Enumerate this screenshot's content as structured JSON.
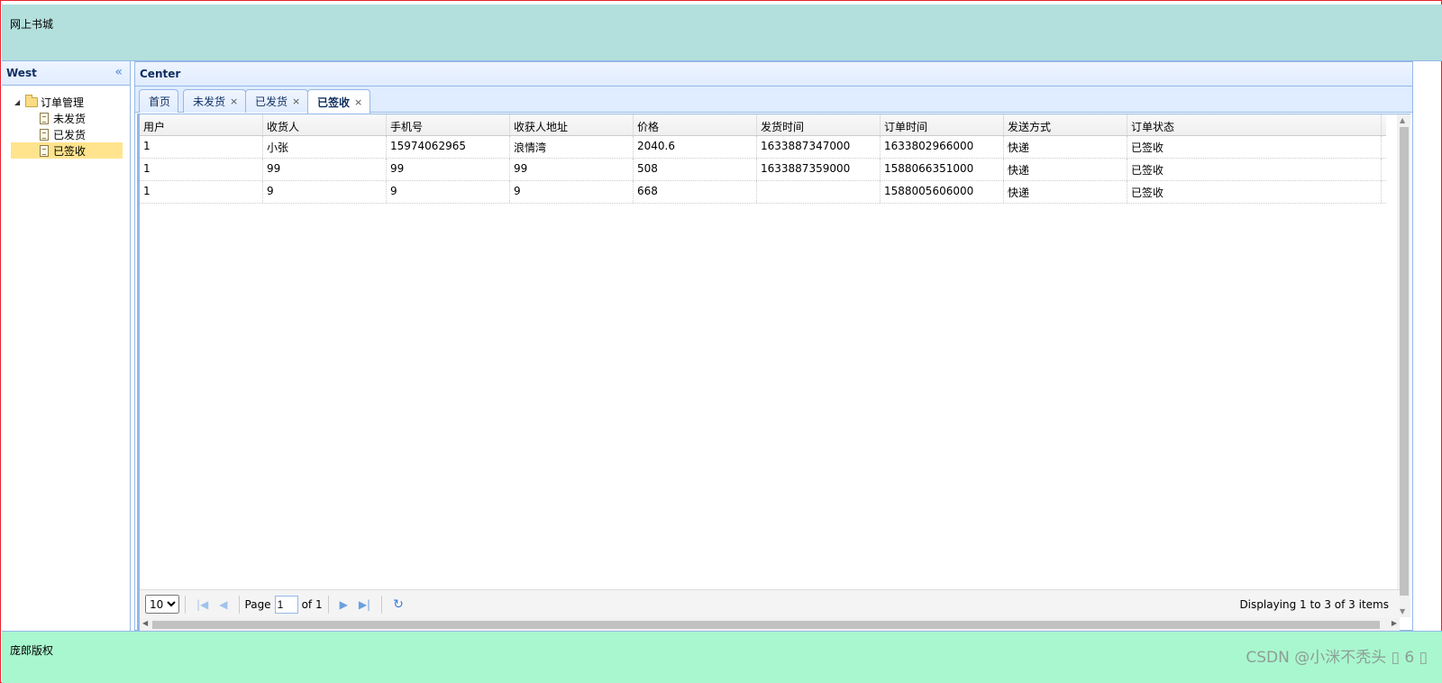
{
  "north": {
    "title": "网上书城"
  },
  "west": {
    "title": "West",
    "collapse_icon": "double-chevron-left-icon",
    "tree": {
      "root": "订单管理",
      "children": [
        "未发货",
        "已发货",
        "已签收"
      ],
      "selected": "已签收"
    }
  },
  "center": {
    "title": "Center",
    "tabs": [
      {
        "label": "首页",
        "closable": false
      },
      {
        "label": "未发货",
        "closable": true
      },
      {
        "label": "已发货",
        "closable": true
      },
      {
        "label": "已签收",
        "closable": true,
        "active": true
      }
    ],
    "close_glyph": "×",
    "grid": {
      "columns": [
        "用户",
        "收货人",
        "手机号",
        "收获人地址",
        "价格",
        "发货时间",
        "订单时间",
        "发送方式",
        "订单状态"
      ],
      "rows": [
        [
          "1",
          "小张",
          "15974062965",
          "浪情湾",
          "2040.6",
          "1633887347000",
          "1633802966000",
          "快递",
          "已签收"
        ],
        [
          "1",
          "99",
          "99",
          "99",
          "508",
          "1633887359000",
          "1588066351000",
          "快递",
          "已签收"
        ],
        [
          "1",
          "9",
          "9",
          "9",
          "668",
          "",
          "1588005606000",
          "快递",
          "已签收"
        ]
      ]
    },
    "pager": {
      "page_size": "10",
      "page_label": "Page",
      "page_value": "1",
      "of_label": "of 1",
      "display_text": "Displaying 1 to 3 of 3 items"
    }
  },
  "south": {
    "copyright": "庞郎版权"
  },
  "watermark": "CSDN @小洣不秃头 ▯ 6 ▯"
}
